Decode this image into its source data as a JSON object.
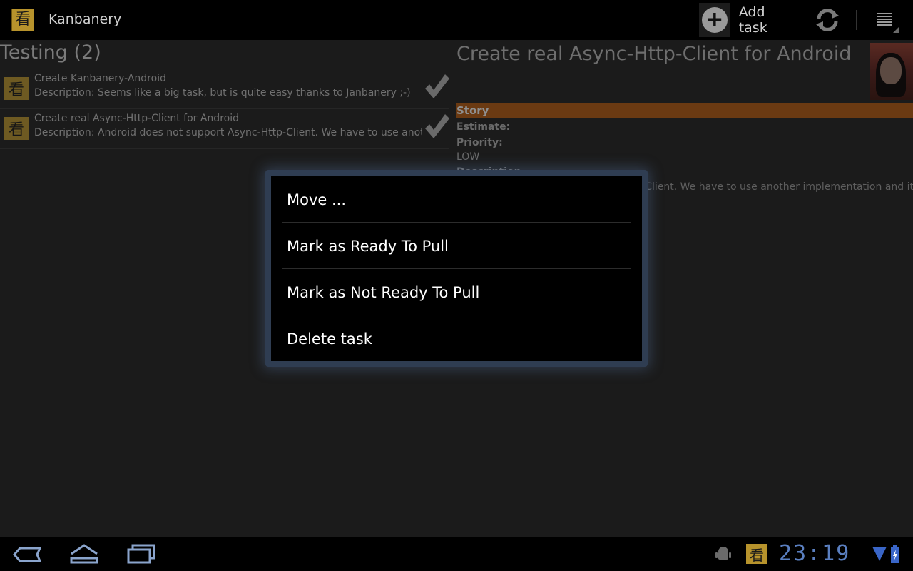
{
  "app": {
    "title": "Kanbanery",
    "icon": "kanbanery-logo-icon",
    "icon_glyph": "看"
  },
  "actionbar": {
    "add_task_label": "Add task",
    "add_icon": "plus-circle-icon",
    "refresh_icon": "refresh-icon",
    "overflow_icon": "overflow-menu-icon"
  },
  "column": {
    "title": "Testing (2)",
    "tasks": [
      {
        "title": "Create Kanbanery-Android",
        "description": "Description: Seems like a big task, but is quite easy thanks to Janbanery ;-)"
      },
      {
        "title": "Create real Async-Http-Client for Android",
        "description": "Description: Android does not support Async-Http-Client. We have to use another implementation"
      }
    ]
  },
  "detail": {
    "title": "Create real Async-Http-Client for Android",
    "type": "Story",
    "estimate_label": "Estimate:",
    "priority_label": "Priority:",
    "priority_value": "LOW",
    "description_label": "Description",
    "description_text": "Android does not support Async-Http-Client. We have to use another implementation and it's best",
    "type_color": "#6b3a12"
  },
  "dialog": {
    "items": [
      {
        "label": "Move ..."
      },
      {
        "label": "Mark as Ready To Pull"
      },
      {
        "label": "Mark as Not Ready To Pull"
      },
      {
        "label": "Delete task"
      }
    ]
  },
  "systembar": {
    "time": "23:19",
    "back_icon": "back-icon",
    "home_icon": "home-icon",
    "recents_icon": "recent-apps-icon",
    "clock_color": "#5a7fc0"
  }
}
